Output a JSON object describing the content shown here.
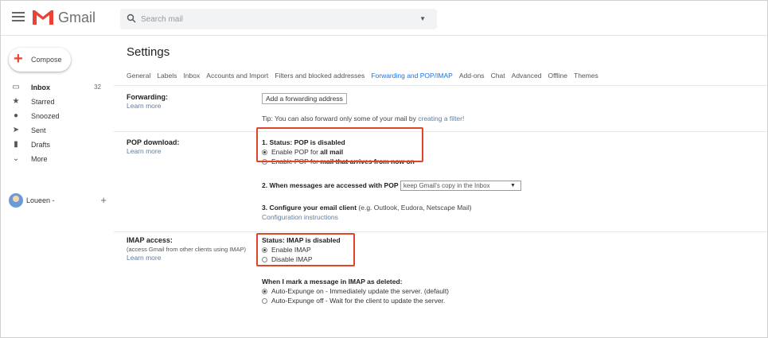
{
  "app": {
    "name": "Gmail",
    "colors": {
      "brand_red": "#ea4335",
      "link": "#5f7ea0",
      "active_tab": "#1a73e8",
      "highlight_box": "#e0452c"
    }
  },
  "header": {
    "search_placeholder": "Search mail",
    "icons": [
      "menu-icon",
      "gmail-logo",
      "search-icon",
      "chevron-down-icon"
    ]
  },
  "sidebar": {
    "compose_label": "Compose",
    "items": [
      {
        "label": "Inbox",
        "count": "32",
        "icon": "inbox-icon"
      },
      {
        "label": "Starred",
        "count": "",
        "icon": "star-icon"
      },
      {
        "label": "Snoozed",
        "count": "",
        "icon": "clock-icon"
      },
      {
        "label": "Sent",
        "count": "",
        "icon": "send-icon"
      },
      {
        "label": "Drafts",
        "count": "",
        "icon": "draft-icon"
      },
      {
        "label": "More",
        "count": "",
        "icon": "chevron-down-icon"
      }
    ],
    "account_label": "Loueen -",
    "account_add": "+"
  },
  "settings": {
    "title": "Settings",
    "tabs": [
      "General",
      "Labels",
      "Inbox",
      "Accounts and Import",
      "Filters and blocked addresses",
      "Forwarding and POP/IMAP",
      "Add-ons",
      "Chat",
      "Advanced",
      "Offline",
      "Themes"
    ],
    "active_tab": "Forwarding and POP/IMAP",
    "forwarding": {
      "title": "Forwarding:",
      "learn_more": "Learn more",
      "add_button": "Add a forwarding address",
      "tip_prefix": "Tip: You can also forward only some of your mail by ",
      "tip_link": "creating a filter!"
    },
    "pop": {
      "title": "POP download:",
      "learn_more": "Learn more",
      "status": "1. Status: POP is disabled",
      "option1_prefix": "Enable POP for ",
      "option1_bold": "all mail",
      "option2_prefix": "Enable POP for ",
      "option2_bold": "mail that arrives from now on",
      "step2_label": "2. When messages are accessed with POP",
      "step2_select": "keep Gmail's copy in the Inbox",
      "step3_label": "3. Configure your email client",
      "step3_hint": "(e.g. Outlook, Eudora, Netscape Mail)",
      "config_link": "Configuration instructions"
    },
    "imap": {
      "title": "IMAP access:",
      "note": "(access Gmail from other clients using IMAP)",
      "learn_more": "Learn more",
      "status": "Status: IMAP is disabled",
      "option1": "Enable IMAP",
      "option2": "Disable IMAP",
      "delete_heading": "When I mark a message in IMAP as deleted:",
      "expunge_on": "Auto-Expunge on - Immediately update the server. (default)",
      "expunge_off": "Auto-Expunge off - Wait for the client to update the server."
    }
  }
}
